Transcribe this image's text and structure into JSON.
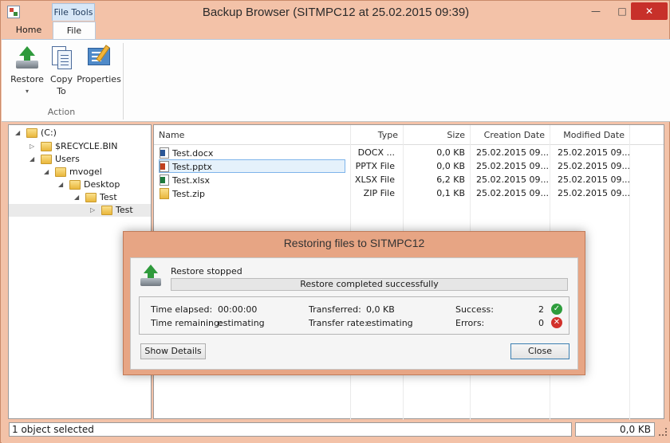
{
  "window": {
    "title": "Backup Browser (SITMPC12 at 25.02.2015 09:39)",
    "context_tab": "File Tools",
    "controls": {
      "minimize": "—",
      "maximize": "□",
      "close": "✕"
    }
  },
  "ribbon": {
    "tabs": [
      "Home",
      "File"
    ],
    "buttons": {
      "restore": "Restore",
      "copy_line1": "Copy",
      "copy_line2": "To",
      "properties": "Properties",
      "dropdown": "▾"
    },
    "group_label": "Action"
  },
  "tree": {
    "items": [
      {
        "label": "(C:)",
        "expander": "◢"
      },
      {
        "label": "$RECYCLE.BIN",
        "expander": "▷"
      },
      {
        "label": "Users",
        "expander": "◢"
      },
      {
        "label": "mvogel",
        "expander": "◢"
      },
      {
        "label": "Desktop",
        "expander": "◢"
      },
      {
        "label": "Test",
        "expander": "◢"
      },
      {
        "label": "Test",
        "expander": "▷"
      }
    ]
  },
  "list": {
    "columns": [
      "Name",
      "Type",
      "Size",
      "Creation Date",
      "Modified Date"
    ],
    "rows": [
      {
        "name": "Test.docx",
        "type": "DOCX ...",
        "size": "0,0 KB",
        "created": "25.02.2015 09...",
        "modified": "25.02.2015 09...",
        "icon": "word-file-icon"
      },
      {
        "name": "Test.pptx",
        "type": "PPTX File",
        "size": "0,0 KB",
        "created": "25.02.2015 09...",
        "modified": "25.02.2015 09...",
        "icon": "powerpoint-file-icon"
      },
      {
        "name": "Test.xlsx",
        "type": "XLSX File",
        "size": "6,2 KB",
        "created": "25.02.2015 09...",
        "modified": "25.02.2015 09...",
        "icon": "excel-file-icon"
      },
      {
        "name": "Test.zip",
        "type": "ZIP File",
        "size": "0,1 KB",
        "created": "25.02.2015 09...",
        "modified": "25.02.2015 09...",
        "icon": "zip-file-icon"
      }
    ],
    "selected_row": 1
  },
  "dialog": {
    "title": "Restoring files to SITMPC12",
    "state": "Restore stopped",
    "progress_text": "Restore completed successfully",
    "progress_fraction": 1,
    "stats": {
      "time_elapsed_label": "Time elapsed:",
      "time_elapsed": "00:00:00",
      "time_remaining_label": "Time remaining:",
      "time_remaining": "estimating",
      "transferred_label": "Transferred:",
      "transferred": "0,0 KB",
      "transfer_rate_label": "Transfer rate:",
      "transfer_rate": "estimating",
      "success_label": "Success:",
      "success": "2",
      "errors_label": "Errors:",
      "errors": "0"
    },
    "buttons": {
      "details": "Show Details",
      "close": "Close"
    },
    "icons": {
      "ok": "✓",
      "error": "✕"
    }
  },
  "statusbar": {
    "left": "1 object selected",
    "right": "0,0 KB"
  },
  "colors": {
    "accent": "#e7a584",
    "success": "#2e9d3c",
    "error": "#d2312b",
    "selection": "#e5f1fb"
  }
}
